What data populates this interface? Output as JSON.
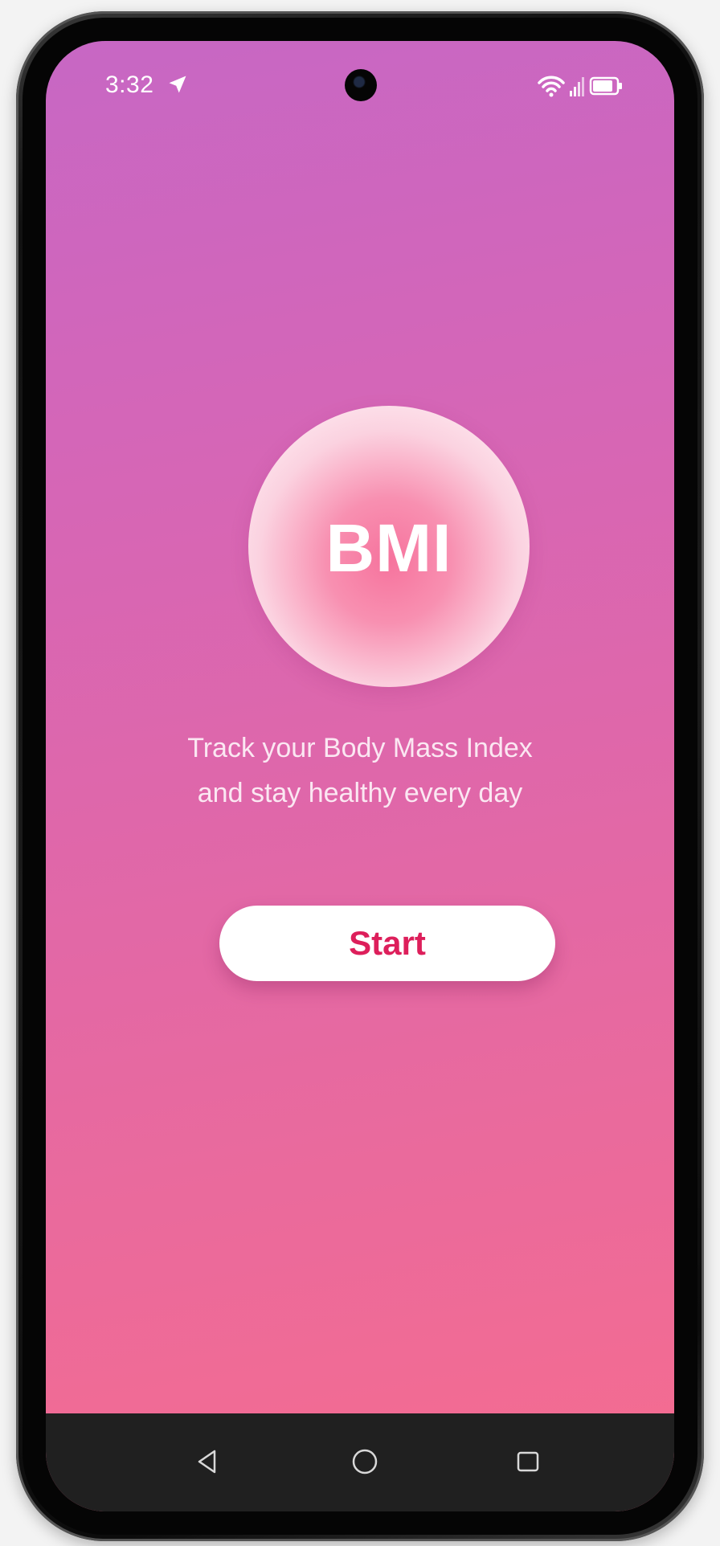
{
  "status_bar": {
    "time": "3:32",
    "location_icon": "location-arrow-icon",
    "wifi_icon": "wifi-icon",
    "signal_icon": "signal-icon",
    "battery_icon": "battery-icon"
  },
  "hero": {
    "logo_text": "BMI",
    "tagline_line1": "Track your Body Mass Index",
    "tagline_line2": "and stay healthy every day"
  },
  "actions": {
    "start_label": "Start"
  },
  "nav": {
    "back_icon": "back-icon",
    "home_icon": "home-icon",
    "recents_icon": "recents-icon"
  },
  "colors": {
    "gradient_top": "#c767c4",
    "gradient_bottom": "#f66c8f",
    "button_text": "#dd1f5b",
    "button_bg": "#ffffff",
    "nav_bar": "#202020"
  }
}
